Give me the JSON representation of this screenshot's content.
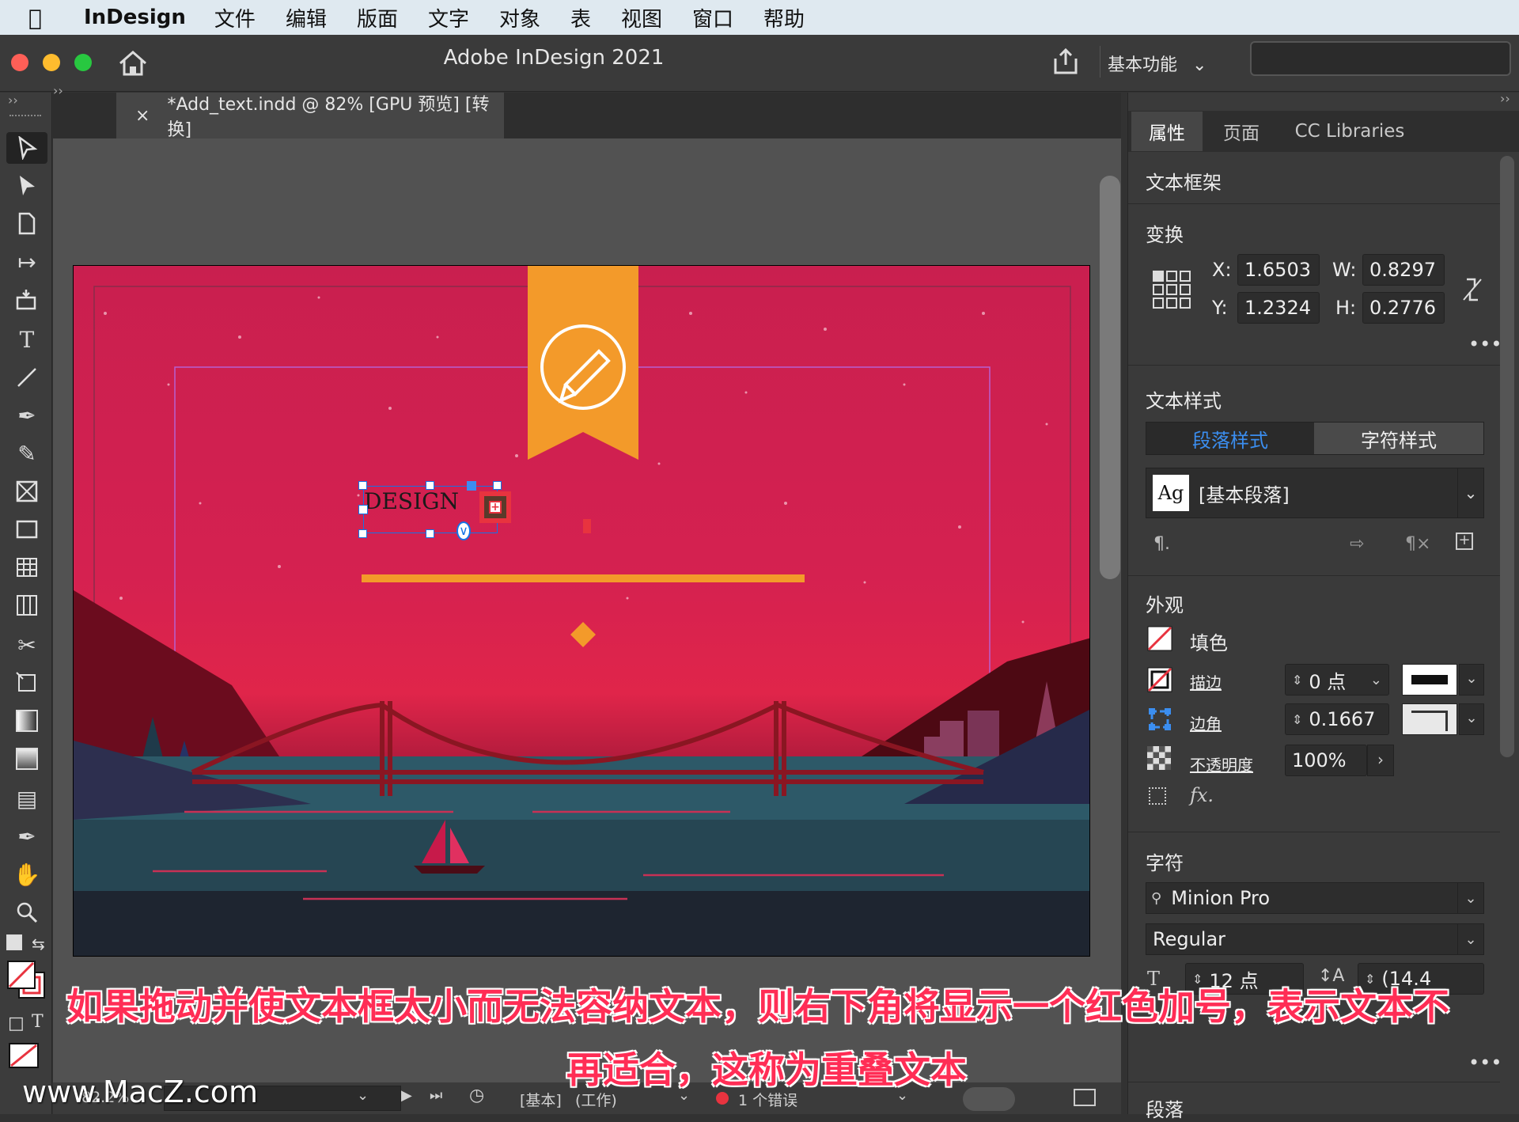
{
  "menubar": {
    "app_name": "InDesign",
    "items": [
      "文件",
      "编辑",
      "版面",
      "文字",
      "对象",
      "表",
      "视图",
      "窗口",
      "帮助"
    ]
  },
  "window": {
    "title": "Adobe InDesign 2021",
    "workspace": "基本功能"
  },
  "document_tab": {
    "close": "×",
    "label": "*Add_text.indd @ 82% [GPU 预览] [转换]"
  },
  "artwork": {
    "text_frame_text": "DESIGN"
  },
  "panel": {
    "tabs": [
      "属性",
      "页面",
      "CC Libraries"
    ],
    "section_type": "文本框架",
    "transform": {
      "heading": "变换",
      "x_label": "X:",
      "x_value": "1.6503",
      "y_label": "Y:",
      "y_value": "1.2324",
      "w_label": "W:",
      "w_value": "0.8297",
      "h_label": "H:",
      "h_value": "0.2776"
    },
    "text_style": {
      "heading": "文本样式",
      "tab_paragraph": "段落样式",
      "tab_character": "字符样式",
      "style_icon": "Ag",
      "style_name": "[基本段落]"
    },
    "appearance": {
      "heading": "外观",
      "fill_label": "填色",
      "stroke_label": "描边",
      "stroke_value": "0 点",
      "corner_label": "边角",
      "corner_value": "0.1667",
      "opacity_label": "不透明度",
      "opacity_value": "100%",
      "fx_label": "fx."
    },
    "character": {
      "heading": "字符",
      "font": "Minion Pro",
      "style": "Regular",
      "size": "12 点",
      "leading": "(14.4"
    },
    "next_heading": "段落"
  },
  "statusbar": {
    "zoom": "82.2%",
    "style": "[基本]",
    "state": "(工作)",
    "errors": "1 个错误"
  },
  "subtitles": {
    "line1": "如果拖动并使文本框太小而无法容纳文本，则右下角将显示一个红色加号，表示文本不",
    "line2": "再适合，这称为重叠文本"
  },
  "watermark": "www.MacZ.com",
  "colors": {
    "accent": "#1473e6",
    "overset": "#e8333f",
    "banner": "#f39a2a"
  }
}
